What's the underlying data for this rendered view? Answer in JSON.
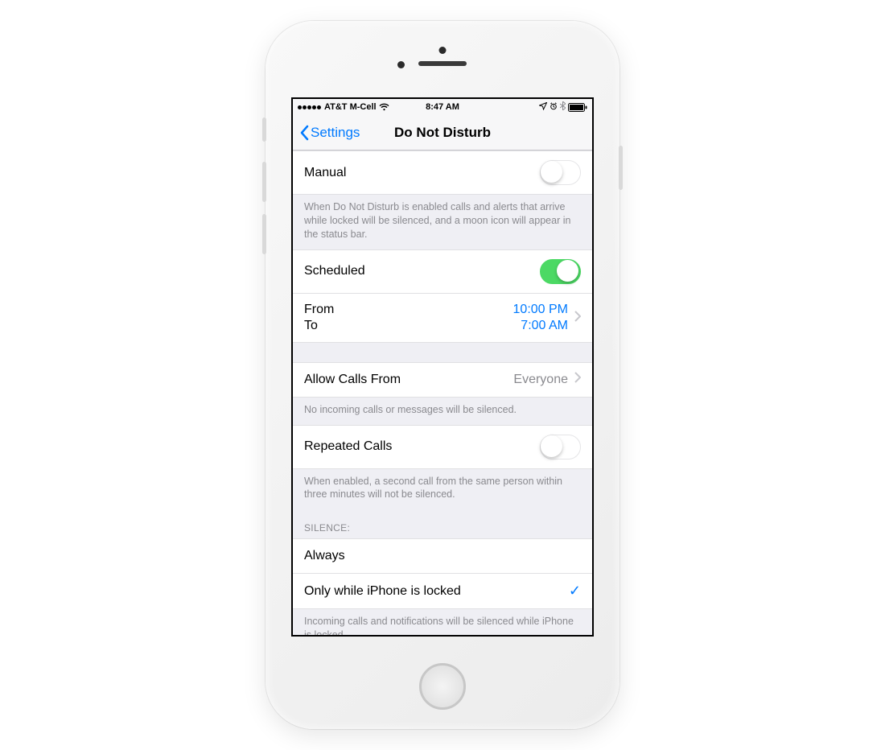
{
  "status": {
    "carrier": "AT&T M-Cell",
    "time": "8:47 AM"
  },
  "nav": {
    "back_label": "Settings",
    "title": "Do Not Disturb"
  },
  "manual": {
    "label": "Manual",
    "on": false,
    "footer": "When Do Not Disturb is enabled calls and alerts that arrive while locked will be silenced, and a moon icon will appear in the status bar."
  },
  "scheduled": {
    "label": "Scheduled",
    "on": true,
    "from_label": "From",
    "to_label": "To",
    "from_value": "10:00 PM",
    "to_value": "7:00 AM"
  },
  "allow": {
    "label": "Allow Calls From",
    "value": "Everyone",
    "footer": "No incoming calls or messages will be silenced."
  },
  "repeated": {
    "label": "Repeated Calls",
    "on": false,
    "footer": "When enabled, a second call from the same person within three minutes will not be silenced."
  },
  "silence": {
    "header": "Silence:",
    "options": [
      "Always",
      "Only while iPhone is locked"
    ],
    "selected_index": 1,
    "footer": "Incoming calls and notifications will be silenced while iPhone is locked."
  }
}
